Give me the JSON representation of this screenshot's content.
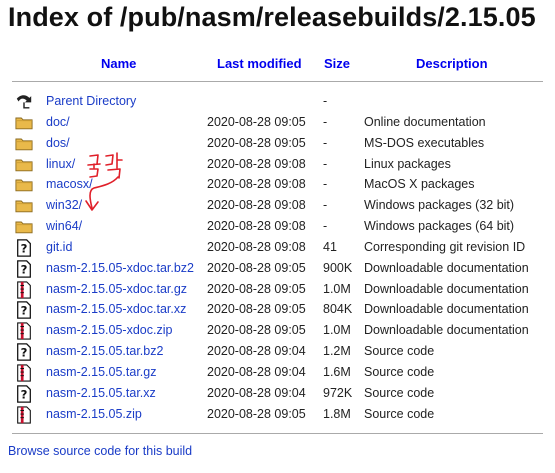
{
  "title": "Index of /pub/nasm/releasebuilds/2.15.05",
  "columns": {
    "name": "Name",
    "last_modified": "Last modified",
    "size": "Size",
    "description": "Description"
  },
  "rows": [
    {
      "icon": "back-icon",
      "name": "Parent Directory",
      "modified": "",
      "size": "-",
      "description": ""
    },
    {
      "icon": "folder-icon",
      "name": "doc/",
      "modified": "2020-08-28 09:05",
      "size": "-",
      "description": "Online documentation"
    },
    {
      "icon": "folder-icon",
      "name": "dos/",
      "modified": "2020-08-28 09:05",
      "size": "-",
      "description": "MS-DOS executables"
    },
    {
      "icon": "folder-icon",
      "name": "linux/",
      "modified": "2020-08-28 09:08",
      "size": "-",
      "description": "Linux packages"
    },
    {
      "icon": "folder-icon",
      "name": "macosx/",
      "modified": "2020-08-28 09:08",
      "size": "-",
      "description": "MacOS X packages"
    },
    {
      "icon": "folder-icon",
      "name": "win32/",
      "modified": "2020-08-28 09:08",
      "size": "-",
      "description": "Windows packages (32 bit)"
    },
    {
      "icon": "folder-icon",
      "name": "win64/",
      "modified": "2020-08-28 09:08",
      "size": "-",
      "description": "Windows packages (64 bit)"
    },
    {
      "icon": "unknown-file-icon",
      "name": "git.id",
      "modified": "2020-08-28 09:08",
      "size": "41",
      "description": "Corresponding git revision ID"
    },
    {
      "icon": "unknown-file-icon",
      "name": "nasm-2.15.05-xdoc.tar.bz2",
      "modified": "2020-08-28 09:05",
      "size": "900K",
      "description": "Downloadable documentation"
    },
    {
      "icon": "compressed-file-icon",
      "name": "nasm-2.15.05-xdoc.tar.gz",
      "modified": "2020-08-28 09:05",
      "size": "1.0M",
      "description": "Downloadable documentation"
    },
    {
      "icon": "unknown-file-icon",
      "name": "nasm-2.15.05-xdoc.tar.xz",
      "modified": "2020-08-28 09:05",
      "size": "804K",
      "description": "Downloadable documentation"
    },
    {
      "icon": "compressed-file-icon",
      "name": "nasm-2.15.05-xdoc.zip",
      "modified": "2020-08-28 09:05",
      "size": "1.0M",
      "description": "Downloadable documentation"
    },
    {
      "icon": "unknown-file-icon",
      "name": "nasm-2.15.05.tar.bz2",
      "modified": "2020-08-28 09:04",
      "size": "1.2M",
      "description": "Source code"
    },
    {
      "icon": "compressed-file-icon",
      "name": "nasm-2.15.05.tar.gz",
      "modified": "2020-08-28 09:04",
      "size": "1.6M",
      "description": "Source code"
    },
    {
      "icon": "unknown-file-icon",
      "name": "nasm-2.15.05.tar.xz",
      "modified": "2020-08-28 09:04",
      "size": "972K",
      "description": "Source code"
    },
    {
      "icon": "compressed-file-icon",
      "name": "nasm-2.15.05.zip",
      "modified": "2020-08-28 09:05",
      "size": "1.8M",
      "description": "Source code"
    }
  ],
  "footer": "Browse source code for this build",
  "annotation": {
    "text": "클릭",
    "color": "#e0202a"
  },
  "colors": {
    "link": "#1a3cc7",
    "header_link": "#0000ee",
    "folder": "#e9b94a",
    "rule": "#aaaaaa"
  }
}
